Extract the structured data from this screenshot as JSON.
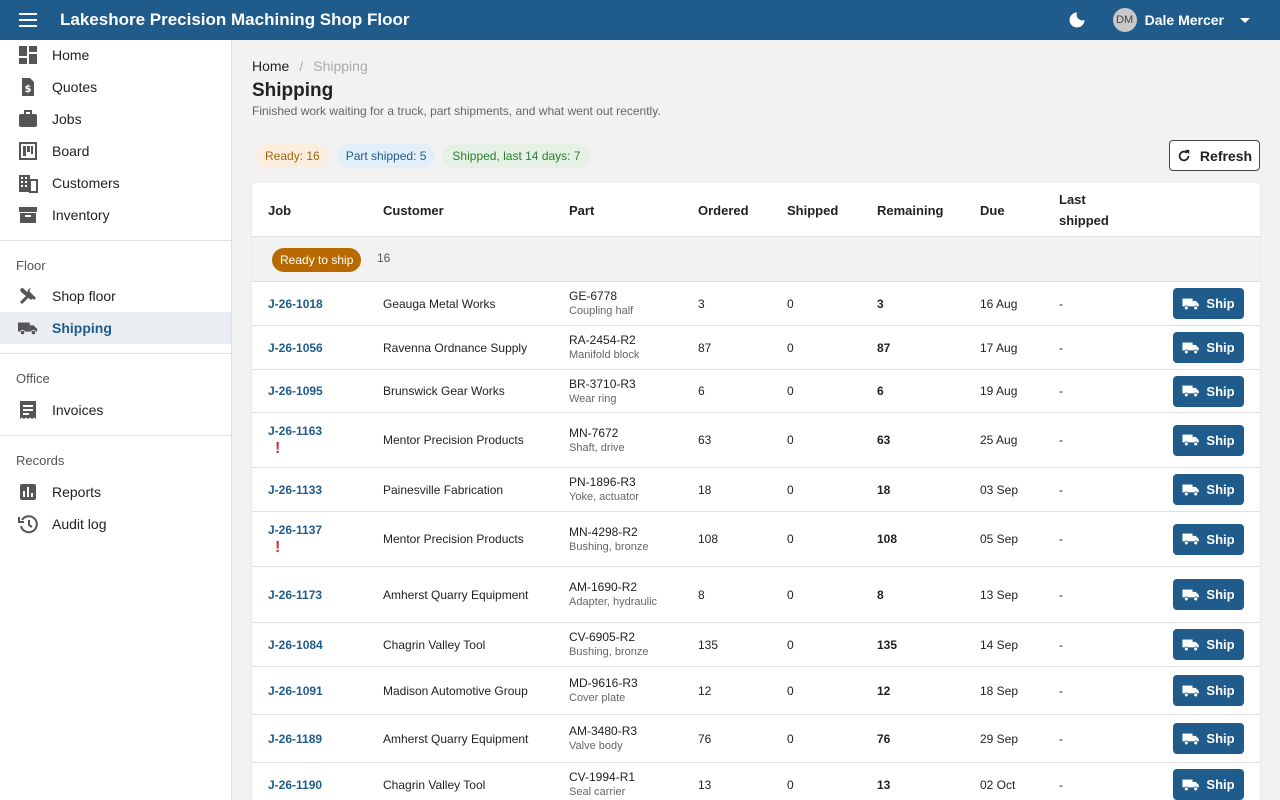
{
  "app": {
    "title": "Lakeshore Precision Machining Shop Floor"
  },
  "user": {
    "initials": "DM",
    "name": "Dale Mercer"
  },
  "sidebar": {
    "items": [
      {
        "label": "Home",
        "icon": "dashboard-icon"
      },
      {
        "label": "Quotes",
        "icon": "quote-icon"
      },
      {
        "label": "Jobs",
        "icon": "briefcase-icon"
      },
      {
        "label": "Board",
        "icon": "board-icon"
      },
      {
        "label": "Customers",
        "icon": "building-icon"
      },
      {
        "label": "Inventory",
        "icon": "archive-icon"
      }
    ],
    "floor_heading": "Floor",
    "floor_items": [
      {
        "label": "Shop floor",
        "icon": "tools-icon"
      },
      {
        "label": "Shipping",
        "icon": "truck-icon",
        "active": true
      }
    ],
    "office_heading": "Office",
    "office_items": [
      {
        "label": "Invoices",
        "icon": "invoice-icon"
      }
    ],
    "records_heading": "Records",
    "records_items": [
      {
        "label": "Reports",
        "icon": "reports-icon"
      },
      {
        "label": "Audit log",
        "icon": "history-icon"
      }
    ]
  },
  "breadcrumb": {
    "home": "Home",
    "sep": "/",
    "current": "Shipping"
  },
  "page": {
    "title": "Shipping",
    "subtitle": "Finished work waiting for a truck, part shipments, and what went out recently."
  },
  "chips": {
    "ready": "Ready: 16",
    "part_shipped": "Part shipped: 5",
    "shipped_recent": "Shipped, last 14 days: 7"
  },
  "refresh_label": "Refresh",
  "table": {
    "columns": {
      "job": "Job",
      "customer": "Customer",
      "part": "Part",
      "ordered": "Ordered",
      "shipped": "Shipped",
      "remaining": "Remaining",
      "due": "Due",
      "last_shipped": "Last shipped"
    },
    "group": {
      "label": "Ready to ship",
      "count": "16"
    },
    "ship_label": "Ship",
    "rows": [
      {
        "job": "J-26-1018",
        "alert": false,
        "customer": "Geauga Metal Works",
        "part_no": "GE-6778",
        "part_desc": "Coupling half",
        "ordered": "3",
        "shipped": "0",
        "remaining": "3",
        "due": "16 Aug",
        "last_shipped": "-"
      },
      {
        "job": "J-26-1056",
        "alert": false,
        "customer": "Ravenna Ordnance Supply",
        "part_no": "RA-2454-R2",
        "part_desc": "Manifold block",
        "ordered": "87",
        "shipped": "0",
        "remaining": "87",
        "due": "17 Aug",
        "last_shipped": "-"
      },
      {
        "job": "J-26-1095",
        "alert": false,
        "customer": "Brunswick Gear Works",
        "part_no": "BR-3710-R3",
        "part_desc": "Wear ring",
        "ordered": "6",
        "shipped": "0",
        "remaining": "6",
        "due": "19 Aug",
        "last_shipped": "-"
      },
      {
        "job": "J-26-1163",
        "alert": true,
        "customer": "Mentor Precision Products",
        "part_no": "MN-7672",
        "part_desc": "Shaft, drive",
        "ordered": "63",
        "shipped": "0",
        "remaining": "63",
        "due": "25 Aug",
        "last_shipped": "-"
      },
      {
        "job": "J-26-1133",
        "alert": false,
        "customer": "Painesville Fabrication",
        "part_no": "PN-1896-R3",
        "part_desc": "Yoke, actuator",
        "ordered": "18",
        "shipped": "0",
        "remaining": "18",
        "due": "03 Sep",
        "last_shipped": "-"
      },
      {
        "job": "J-26-1137",
        "alert": true,
        "customer": "Mentor Precision Products",
        "part_no": "MN-4298-R2",
        "part_desc": "Bushing, bronze",
        "ordered": "108",
        "shipped": "0",
        "remaining": "108",
        "due": "05 Sep",
        "last_shipped": "-"
      },
      {
        "job": "J-26-1173",
        "alert": false,
        "customer": "Amherst Quarry Equipment",
        "part_no": "AM-1690-R2",
        "part_desc": "Adapter, hydraulic",
        "ordered": "8",
        "shipped": "0",
        "remaining": "8",
        "due": "13 Sep",
        "last_shipped": "-"
      },
      {
        "job": "J-26-1084",
        "alert": false,
        "customer": "Chagrin Valley Tool",
        "part_no": "CV-6905-R2",
        "part_desc": "Bushing, bronze",
        "ordered": "135",
        "shipped": "0",
        "remaining": "135",
        "due": "14 Sep",
        "last_shipped": "-"
      },
      {
        "job": "J-26-1091",
        "alert": false,
        "customer": "Madison Automotive Group",
        "part_no": "MD-9616-R3",
        "part_desc": "Cover plate",
        "ordered": "12",
        "shipped": "0",
        "remaining": "12",
        "due": "18 Sep",
        "last_shipped": "-"
      },
      {
        "job": "J-26-1189",
        "alert": false,
        "customer": "Amherst Quarry Equipment",
        "part_no": "AM-3480-R3",
        "part_desc": "Valve body",
        "ordered": "76",
        "shipped": "0",
        "remaining": "76",
        "due": "29 Sep",
        "last_shipped": "-"
      },
      {
        "job": "J-26-1190",
        "alert": false,
        "customer": "Chagrin Valley Tool",
        "part_no": "CV-1994-R1",
        "part_desc": "Seal carrier",
        "ordered": "13",
        "shipped": "0",
        "remaining": "13",
        "due": "02 Oct",
        "last_shipped": "-"
      }
    ]
  },
  "colors": {
    "primary": "#1f5b8b",
    "ready_badge": "#b86a00",
    "alert": "#d32f2f",
    "chip_ready_bg": "#fbeede",
    "chip_part_bg": "#e2eef8",
    "chip_shipped_bg": "#e4f1e4"
  }
}
